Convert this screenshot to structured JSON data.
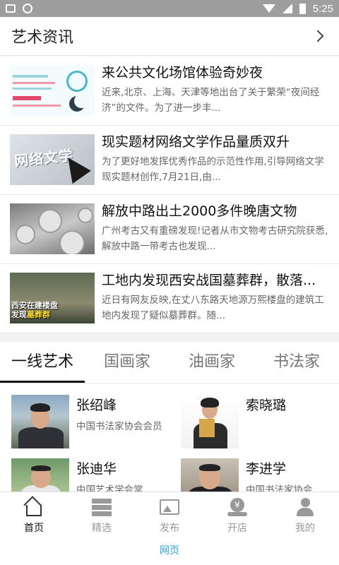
{
  "status_bar": {
    "time": "5:25"
  },
  "section": {
    "title": "艺术资讯"
  },
  "news": [
    {
      "title": "来公共文化场馆体验奇妙夜",
      "desc": "近来,北京、上海、天津等地出台了关于繁荣“夜间经济”的文件。为了进一步丰..."
    },
    {
      "title": "现实题材网络文学作品量质双升",
      "desc": "为了更好地发挥优秀作品的示范性作用,引导网络文学现实题材创作,7月21日,由...",
      "thumb_text": "网络文学"
    },
    {
      "title": "解放中路出土2000多件晚唐文物",
      "desc": "广州考古又有重磅发现!记者从市文物考古研究院获悉,解放中路一带考古也发现..."
    },
    {
      "title": "工地内发现西安战国墓葬群，散落...",
      "desc": "近日有网友反映,在丈八东路天地源万熙楼盘的建筑工地内发现了疑似墓葬群。随...",
      "thumb_text_line1": "西安在建楼盘",
      "thumb_text_line2a": "发现",
      "thumb_text_line2b": "墓葬群"
    }
  ],
  "tabs": [
    "一线艺术",
    "国画家",
    "油画家",
    "书法家"
  ],
  "artists": [
    {
      "name": "张绍峰",
      "role": "中国书法家协会会员"
    },
    {
      "name": "索晓璐",
      "role": ""
    },
    {
      "name": "张迪华",
      "role": "中国艺术学会常"
    },
    {
      "name": "李进学",
      "role": "中国书法家协会"
    }
  ],
  "bottom_nav": [
    {
      "label": "首页",
      "icon": "home-icon"
    },
    {
      "label": "精选",
      "icon": "stack-icon"
    },
    {
      "label": "发布",
      "icon": "image-icon"
    },
    {
      "label": "开店",
      "icon": "shop-icon"
    },
    {
      "label": "我的",
      "icon": "user-icon"
    }
  ],
  "webpage_link": "网页"
}
